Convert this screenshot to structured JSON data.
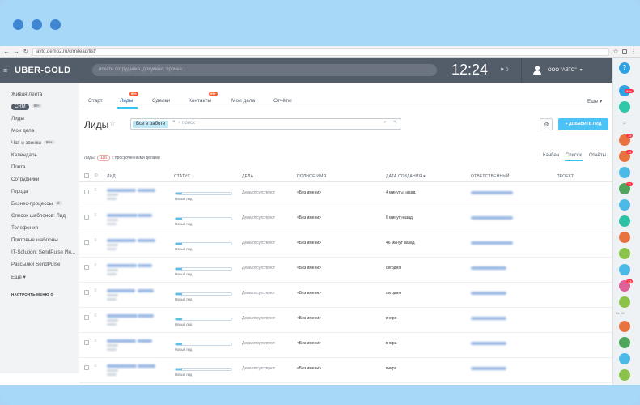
{
  "url": "avto.demo2.ru/crm/lead/list/",
  "app": {
    "logo": "UBER-GOLD",
    "search_placeholder": "искать сотрудника, документ, прочее...",
    "clock": "12:24",
    "flags": "0",
    "company": "ООО \"АВТО\"",
    "help": "?"
  },
  "right_badges": {
    "top": "99+",
    "call1": "19",
    "call2": "11",
    "call3": "11",
    "call4": "13",
    "time": "Вт, 28"
  },
  "sidebar": {
    "items": [
      "Живая лента",
      "CRM",
      "Лиды",
      "Мои дела",
      "Чат и звонки",
      "Календарь",
      "Почта",
      "Сотрудники",
      "Города",
      "Бизнес-процессы",
      "Список шаблонов: Лид",
      "Телефония",
      "Почтовые шаблоны",
      "IT-Solution: SendPulse Ин...",
      "Рассылки SendPulse",
      "Ещё"
    ],
    "crm_count": "99+",
    "chat_count": "99+",
    "bp_count": "3",
    "settings": "НАСТРОИТЬ МЕНЮ"
  },
  "tabs": [
    {
      "label": "Старт"
    },
    {
      "label": "Лиды",
      "badge": "99+"
    },
    {
      "label": "Сделки"
    },
    {
      "label": "Контакты",
      "badge": "99+"
    },
    {
      "label": "Мои дела"
    },
    {
      "label": "Отчёты"
    }
  ],
  "more": "Еще",
  "page_title": "Лиды",
  "filter": {
    "chip": "Все в работе",
    "placeholder": "+ поиск"
  },
  "add_button": "ДОБАВИТЬ ЛИД",
  "stats": {
    "label": "Лиды:",
    "count": "116",
    "suffix": "с просроченными делами"
  },
  "views": [
    "Канбан",
    "Список",
    "Отчёты"
  ],
  "columns": [
    "ЛИД",
    "СТАТУС",
    "ДЕЛА",
    "ПОЛНОЕ ИМЯ",
    "ДАТА СОЗДАНИЯ",
    "ОТВЕТСТВЕННЫЙ",
    "ПРОЕКТ"
  ],
  "rows": [
    {
      "status": "Новый лид",
      "progress": 0.12,
      "deals": "Дела отсутствуют",
      "name": "<Без имени>",
      "date": "4 минуты назад"
    },
    {
      "status": "Новый лид",
      "progress": 0.12,
      "deals": "Дела отсутствуют",
      "name": "<Без имени>",
      "date": "6 минут назад"
    },
    {
      "status": "Новый лид",
      "progress": 0.12,
      "deals": "Дела отсутствуют",
      "name": "<Без имени>",
      "date": "46 минут назад"
    },
    {
      "status": "Новый лид",
      "progress": 0.12,
      "deals": "Дела отсутствуют",
      "name": "<Без имени>",
      "date": "сегодня"
    },
    {
      "status": "Новый лид",
      "progress": 0.12,
      "deals": "Дела отсутствуют",
      "name": "<Без имени>",
      "date": "сегодня"
    },
    {
      "status": "Новый лид",
      "progress": 0.12,
      "deals": "Дела отсутствуют",
      "name": "<Без имени>",
      "date": "вчера"
    },
    {
      "status": "Новый лид",
      "progress": 0.12,
      "deals": "Дела отсутствуют",
      "name": "<Без имени>",
      "date": "вчера"
    },
    {
      "status": "Новый лид",
      "progress": 0.12,
      "deals": "Дела отсутствуют",
      "name": "<Без имени>",
      "date": "вчера"
    },
    {
      "status": "Ремонт/обслуживание одобрены менеджером",
      "progress": 0.5,
      "deals": "Дела отсутствуют",
      "name": "Денис Шакиров",
      "date": "вчера",
      "green": true
    }
  ]
}
